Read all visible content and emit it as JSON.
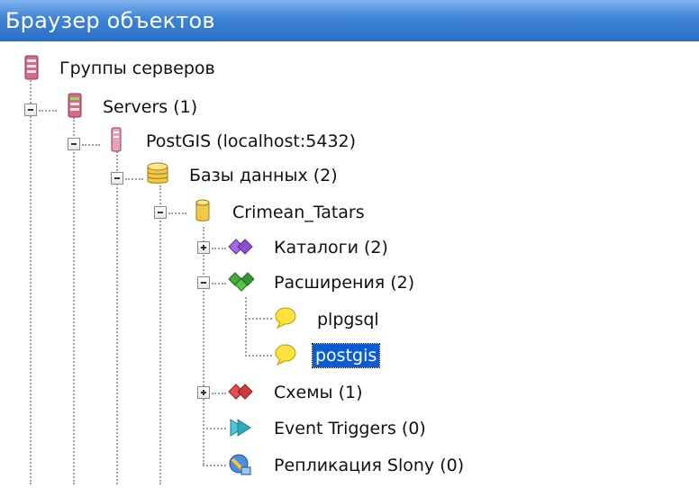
{
  "window": {
    "title": "Браузер объектов"
  },
  "tree": {
    "server_groups": "Группы серверов",
    "servers": "Servers (1)",
    "server": "PostGIS (localhost:5432)",
    "databases": "Базы данных (2)",
    "database": "Crimean_Tatars",
    "catalogs": "Каталоги (2)",
    "extensions": "Расширения (2)",
    "ext_plpgsql": "plpgsql",
    "ext_postgis": "postgis",
    "schemas": "Схемы (1)",
    "event_triggers": "Event Triggers (0)",
    "slony": "Репликация Slony (0)"
  },
  "colors": {
    "titlebar": "#3e83d6",
    "selection": "#0a5bd6"
  }
}
